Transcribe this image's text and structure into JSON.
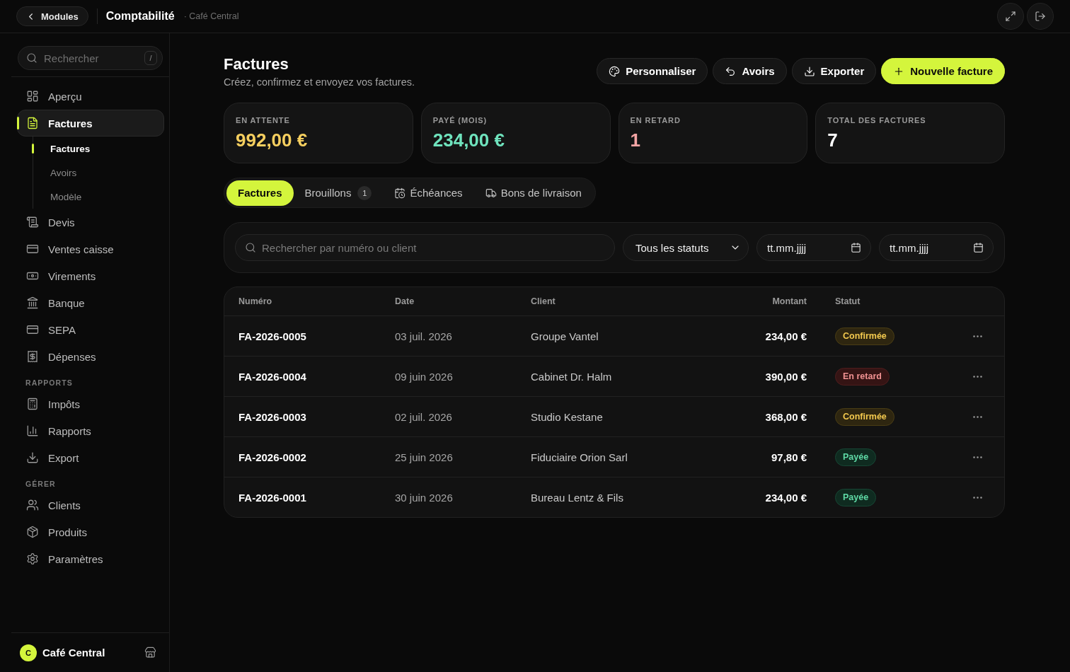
{
  "top_bar": {
    "back_button": "Modules",
    "title": "Comptabilité",
    "subtitle": "· Café Central"
  },
  "sidebar": {
    "search": {
      "placeholder": "Rechercher",
      "shortcut": "/"
    },
    "sections": [
      {
        "items": [
          {
            "label": "Aperçu",
            "selected": false
          },
          {
            "label": "Factures",
            "selected": true,
            "children": [
              {
                "label": "Factures",
                "selected": true
              },
              {
                "label": "Avoirs",
                "selected": false
              },
              {
                "label": "Modèle",
                "selected": false
              }
            ]
          },
          {
            "label": "Devis",
            "selected": false
          },
          {
            "label": "Ventes caisse",
            "selected": false
          },
          {
            "label": "Virements",
            "selected": false
          },
          {
            "label": "Banque",
            "selected": false
          },
          {
            "label": "SEPA",
            "selected": false
          },
          {
            "label": "Dépenses",
            "selected": false
          }
        ]
      },
      {
        "title": "RAPPORTS",
        "items": [
          {
            "label": "Impôts",
            "selected": false
          },
          {
            "label": "Rapports",
            "selected": false
          },
          {
            "label": "Export",
            "selected": false
          }
        ]
      },
      {
        "title": "GÉRER",
        "items": [
          {
            "label": "Clients",
            "selected": false
          },
          {
            "label": "Produits",
            "selected": false
          },
          {
            "label": "Paramètres",
            "selected": false
          }
        ]
      }
    ],
    "footer": {
      "avatar": "C",
      "name": "Café Central"
    }
  },
  "page": {
    "title": "Factures",
    "subtitle": "Créez, confirmez et envoyez vos factures.",
    "actions": [
      {
        "label": "Personnaliser",
        "kind": "secondary"
      },
      {
        "label": "Avoirs",
        "kind": "secondary"
      },
      {
        "label": "Exporter",
        "kind": "secondary"
      },
      {
        "label": "Nouvelle facture",
        "kind": "primary"
      }
    ]
  },
  "stats": [
    {
      "label": "EN ATTENTE",
      "value": "992,00 €",
      "kind": "pending"
    },
    {
      "label": "PAYÉ (MOIS)",
      "value": "234,00 €",
      "kind": "paid"
    },
    {
      "label": "EN RETARD",
      "value": "1",
      "kind": "overdue"
    },
    {
      "label": "TOTAL DES FACTURES",
      "value": "7",
      "kind": "total"
    }
  ],
  "tabs": [
    {
      "label": "Factures",
      "selected": true
    },
    {
      "label": "Brouillons",
      "selected": false,
      "badge": "1"
    },
    {
      "label": "Échéances",
      "selected": false
    },
    {
      "label": "Bons de livraison",
      "selected": false
    }
  ],
  "filters": {
    "search": {
      "placeholder": "Rechercher par numéro ou client"
    },
    "status_select": {
      "value": "Tous les statuts"
    },
    "date_from": {
      "placeholder": "tt.mm.jjjj"
    },
    "date_to": {
      "placeholder": "tt.mm.jjjj"
    }
  },
  "table": {
    "columns": [
      "Numéro",
      "Date",
      "Client",
      "Montant",
      "Statut"
    ],
    "rows": [
      {
        "number": "FA-2026-0005",
        "date": "03 juil. 2026",
        "client": "Groupe Vantel",
        "amount": "234,00 €",
        "status": {
          "label": "Confirmée",
          "kind": "confirmed"
        }
      },
      {
        "number": "FA-2026-0004",
        "date": "09 juin 2026",
        "client": "Cabinet Dr. Halm",
        "amount": "390,00 €",
        "status": {
          "label": "En retard",
          "kind": "overdue"
        }
      },
      {
        "number": "FA-2026-0003",
        "date": "02 juil. 2026",
        "client": "Studio Kestane",
        "amount": "368,00 €",
        "status": {
          "label": "Confirmée",
          "kind": "confirmed"
        }
      },
      {
        "number": "FA-2026-0002",
        "date": "25 juin 2026",
        "client": "Fiduciaire Orion Sarl",
        "amount": "97,80 €",
        "status": {
          "label": "Payée",
          "kind": "paid"
        }
      },
      {
        "number": "FA-2026-0001",
        "date": "30 juin 2026",
        "client": "Bureau Lentz & Fils",
        "amount": "234,00 €",
        "status": {
          "label": "Payée",
          "kind": "paid"
        }
      }
    ]
  }
}
